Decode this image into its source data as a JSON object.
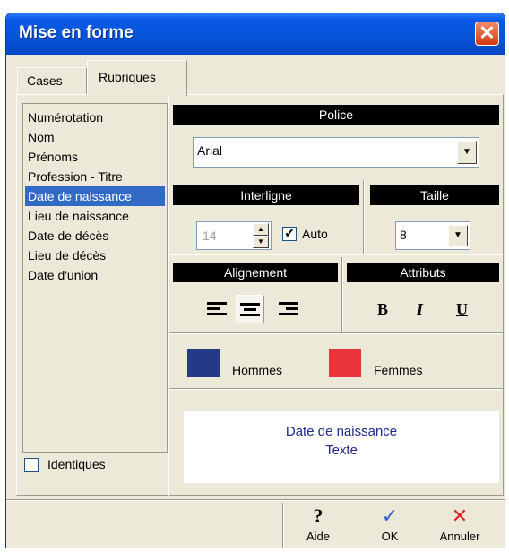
{
  "window": {
    "title": "Mise en forme",
    "close_symbol": "✕"
  },
  "tabs": [
    {
      "label": "Cases"
    },
    {
      "label": "Rubriques",
      "active": true
    }
  ],
  "fields_list": {
    "items": [
      {
        "label": "Numérotation"
      },
      {
        "label": "Nom"
      },
      {
        "label": "Prénoms"
      },
      {
        "label": "Profession - Titre"
      },
      {
        "label": "Date de naissance",
        "selected": true
      },
      {
        "label": "Lieu de naissance"
      },
      {
        "label": "Date de décès"
      },
      {
        "label": "Lieu de décès"
      },
      {
        "label": "Date d'union"
      }
    ],
    "identiques_label": "Identiques",
    "identiques_checked": false
  },
  "police": {
    "header": "Police",
    "font_value": "Arial"
  },
  "interligne": {
    "header": "Interligne",
    "value": "14",
    "auto_label": "Auto",
    "auto_checked": true
  },
  "taille": {
    "header": "Taille",
    "value": "8"
  },
  "alignement": {
    "header": "Alignement",
    "selected": "center"
  },
  "attributs": {
    "header": "Attributs",
    "bold": "B",
    "italic": "I",
    "underline": "U"
  },
  "colors": {
    "hommes_label": "Hommes",
    "hommes_color": "#233a86",
    "femmes_label": "Femmes",
    "femmes_color": "#e8343a"
  },
  "preview": {
    "line1": "Date de naissance",
    "line2": "Texte"
  },
  "toolbar": {
    "aide_label": "Aide",
    "aide_icon": "?",
    "ok_label": "OK",
    "ok_icon": "✓",
    "annuler_label": "Annuler",
    "annuler_icon": "✕"
  }
}
